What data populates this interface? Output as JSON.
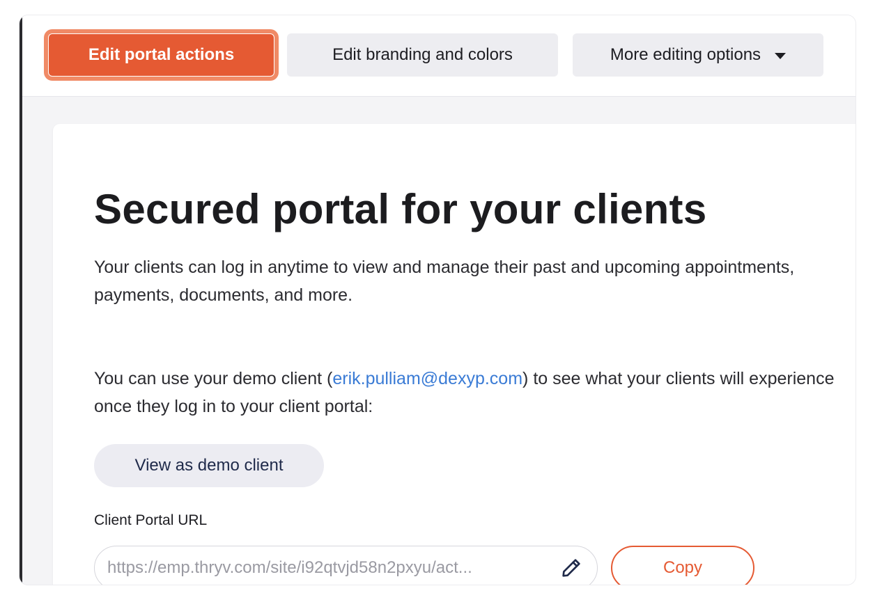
{
  "toolbar": {
    "edit_actions_label": "Edit portal actions",
    "edit_branding_label": "Edit branding and colors",
    "more_options_label": "More editing options"
  },
  "content": {
    "title": "Secured portal for your clients",
    "description": "Your clients can log in anytime to view and manage their past and upcoming appointments, payments, documents, and more.",
    "demo_text_before": "You can use your demo client (",
    "demo_email": "erik.pulliam@dexyp.com",
    "demo_text_after": ") to see what your clients will experience once they log in to your client portal:",
    "demo_button_label": "View as demo client",
    "url_label": "Client Portal URL",
    "url_value": "https://emp.thryv.com/site/i92qtvjd58n2pxyu/act...",
    "copy_label": "Copy"
  },
  "colors": {
    "accent": "#e55a33",
    "link": "#3a7bd5",
    "title": "#1c1c1f"
  },
  "icons": {
    "more_options": "chevron-down-icon",
    "edit_url": "pencil-icon"
  }
}
